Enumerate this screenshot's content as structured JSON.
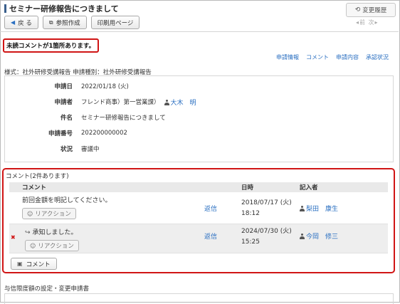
{
  "page": {
    "title": "セミナー研修報告につきまして",
    "history_button": "変更履歴",
    "pager": "◂前 次▸"
  },
  "toolbar": {
    "back_label": "戻 る",
    "reference_label": "参照作成",
    "print_label": "印刷用ページ"
  },
  "notice": "未読コメントが1箇所あります。",
  "sublinks": [
    "申請情報",
    "コメント",
    "申請内容",
    "承認状況"
  ],
  "form_line": "様式：社外研修受講報告 申請種別：社外研修受講報告",
  "info": {
    "rows": [
      {
        "label": "申請日",
        "value": "2022/01/18 (火)"
      },
      {
        "label": "申請者",
        "value": "フレンド商事）第一営業課）",
        "person": "大木　明"
      },
      {
        "label": "件名",
        "value": "セミナー研修報告につきまして"
      },
      {
        "label": "申請番号",
        "value": "202200000002"
      },
      {
        "label": "状況",
        "value": "審議中"
      }
    ]
  },
  "comments": {
    "heading": "コメント(2件あります)",
    "headers": {
      "comment": "コメント",
      "date": "日時",
      "author": "記入者"
    },
    "rows": [
      {
        "text": "前回金額を明記してください。",
        "reaction": "リアクション",
        "reply": "返信",
        "date": "2018/07/17 (火)",
        "time": "18:12",
        "author": "梨田　康生",
        "unread": false
      },
      {
        "text": "承知しました。",
        "reaction": "リアクション",
        "reply": "返信",
        "date": "2024/07/30 (火)",
        "time": "15:25",
        "author": "今岡　修三",
        "unread": true
      }
    ],
    "comment_button": "コメント"
  },
  "credit_section": {
    "title": "与信限度額の設定・変更申請書"
  },
  "colors": {
    "accent": "#2a6fc1",
    "alert": "#d01515"
  }
}
